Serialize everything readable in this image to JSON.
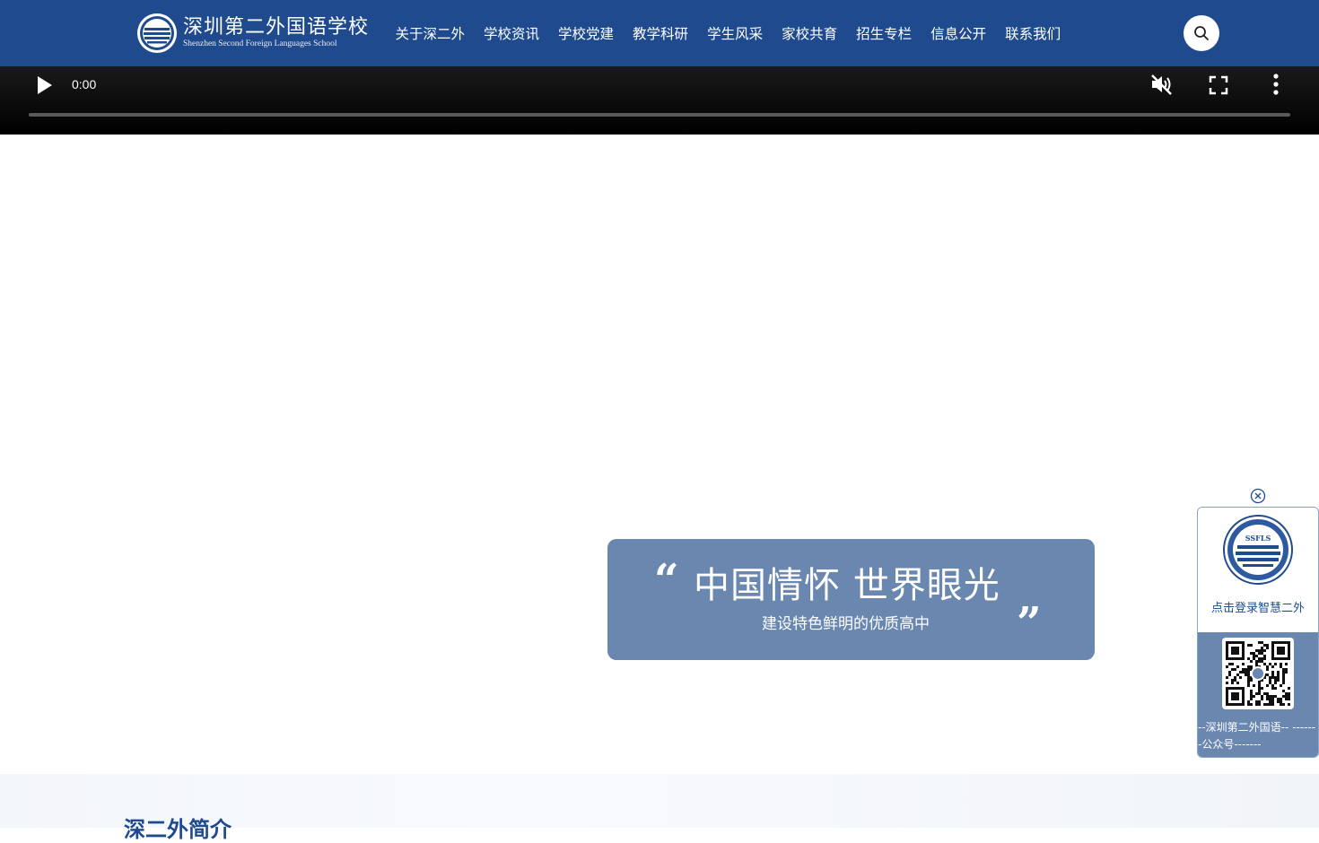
{
  "header": {
    "logo_cn": "深圳第二外国语学校",
    "logo_en": "Shenzhen Second Foreign Languages School",
    "nav": [
      "关于深二外",
      "学校资讯",
      "学校党建",
      "教学科研",
      "学生风采",
      "家校共育",
      "招生专栏",
      "信息公开",
      "联系我们"
    ],
    "search_icon": "search-icon",
    "bg_color": "#1f4b8e"
  },
  "video": {
    "time": "0:00",
    "progress": 0,
    "icons": [
      "play-icon",
      "muted-icon",
      "fullscreen-icon",
      "more-vert-icon"
    ]
  },
  "slogan": {
    "main": "中国情怀 世界眼光",
    "sub": "建设特色鲜明的优质高中",
    "quote_open": "“",
    "quote_close": "”"
  },
  "float_widget": {
    "badge_text": "SSFLS",
    "login_label": "点击登录智慧二外",
    "qr_caption": "--深圳第二外国语-- -------公众号-------"
  },
  "intro": {
    "title": "深二外简介"
  }
}
